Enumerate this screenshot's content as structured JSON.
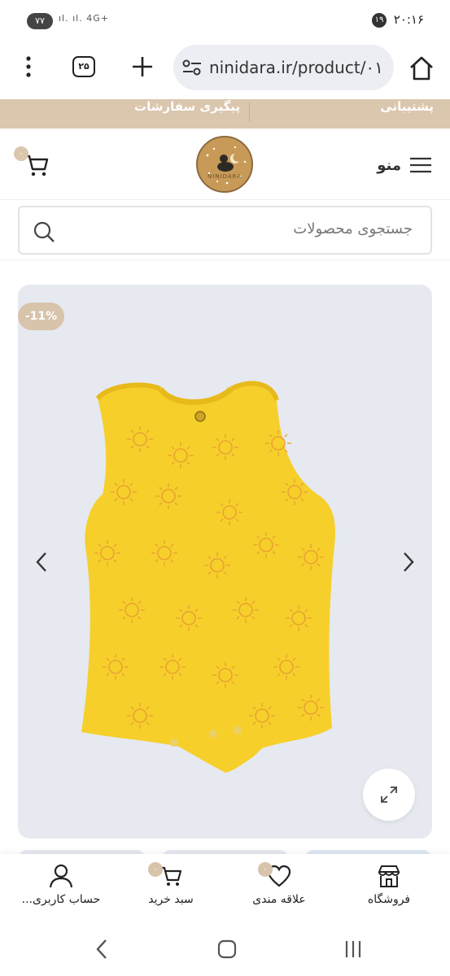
{
  "status_bar": {
    "time": "۲۰:۱۶",
    "notification_count": "۱۹",
    "battery": "۷۷",
    "network": "4G+"
  },
  "browser": {
    "url": "ninidara.ir/product/۰۱",
    "tab_count": "۲۵"
  },
  "top_strip": {
    "support": "پشتیبانی",
    "order_tracking": "پیگیری سفارشات"
  },
  "header": {
    "menu_label": "منو",
    "cart_count": "۰",
    "logo_text": "NINIDARA"
  },
  "search": {
    "placeholder": "جستجوی محصولات"
  },
  "product": {
    "discount": "-11%"
  },
  "bottom_nav": {
    "shop": "فروشگاه",
    "wishlist": "علاقه مندی",
    "wishlist_count": "۰",
    "cart": "سبد خرید",
    "cart_count": "۰",
    "account": "حساب کاربری..."
  },
  "colors": {
    "accent": "#dbc6ae",
    "product_bg": "#e6e9f0",
    "garment": "#f6cf2b"
  }
}
